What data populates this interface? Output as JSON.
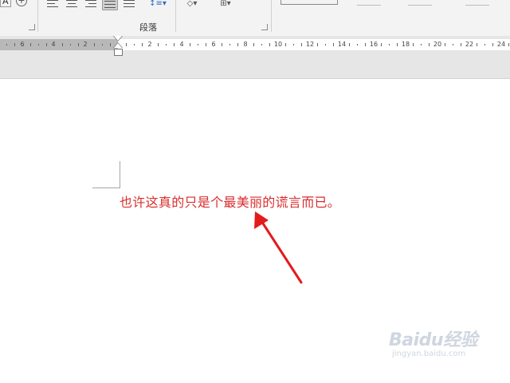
{
  "ribbon": {
    "paragraph_group_label": "段落",
    "top_left_letter": "A"
  },
  "ruler": {
    "left_numbers": [
      "6",
      "4",
      "2"
    ],
    "right_numbers": [
      "2",
      "4",
      "6",
      "8",
      "10",
      "12",
      "14",
      "16",
      "18",
      "20",
      "22",
      "24"
    ]
  },
  "document": {
    "text": "也许这真的只是个最美丽的谎言而已。",
    "text_color": "#d92d2d"
  },
  "annotation": {
    "arrow_color": "#e31b1b"
  },
  "watermark": {
    "logo": "Baidu经验",
    "url": "jingyan.baidu.com"
  }
}
